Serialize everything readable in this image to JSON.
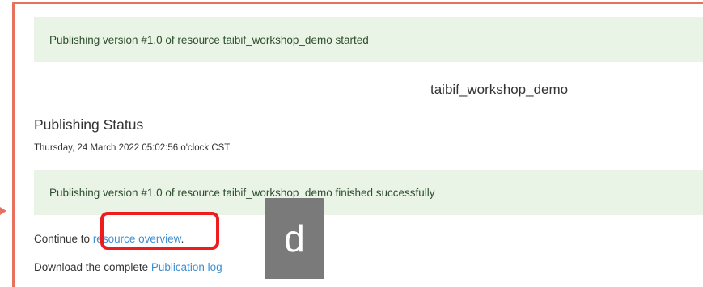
{
  "alerts": {
    "started": "Publishing version #1.0 of resource taibif_workshop_demo started",
    "finished": "Publishing version #1.0 of resource taibif_workshop_demo finished successfully"
  },
  "resource": {
    "title": "taibif_workshop_demo"
  },
  "status": {
    "heading": "Publishing Status",
    "timestamp": "Thursday, 24 March 2022 05:02:56 o'clock CST"
  },
  "links": {
    "continue_prefix": "Continue to ",
    "continue_link": "resource overview",
    "continue_suffix": ".",
    "download_prefix": "Download the complete ",
    "download_link": "Publication log"
  },
  "annotation": {
    "step_label": "d"
  },
  "colors": {
    "frame": "#e8705f",
    "highlight": "#ee1c1c",
    "alert_bg": "#e9f4e6",
    "link": "#3f8fd1",
    "badge_bg": "#7a7a7a"
  }
}
